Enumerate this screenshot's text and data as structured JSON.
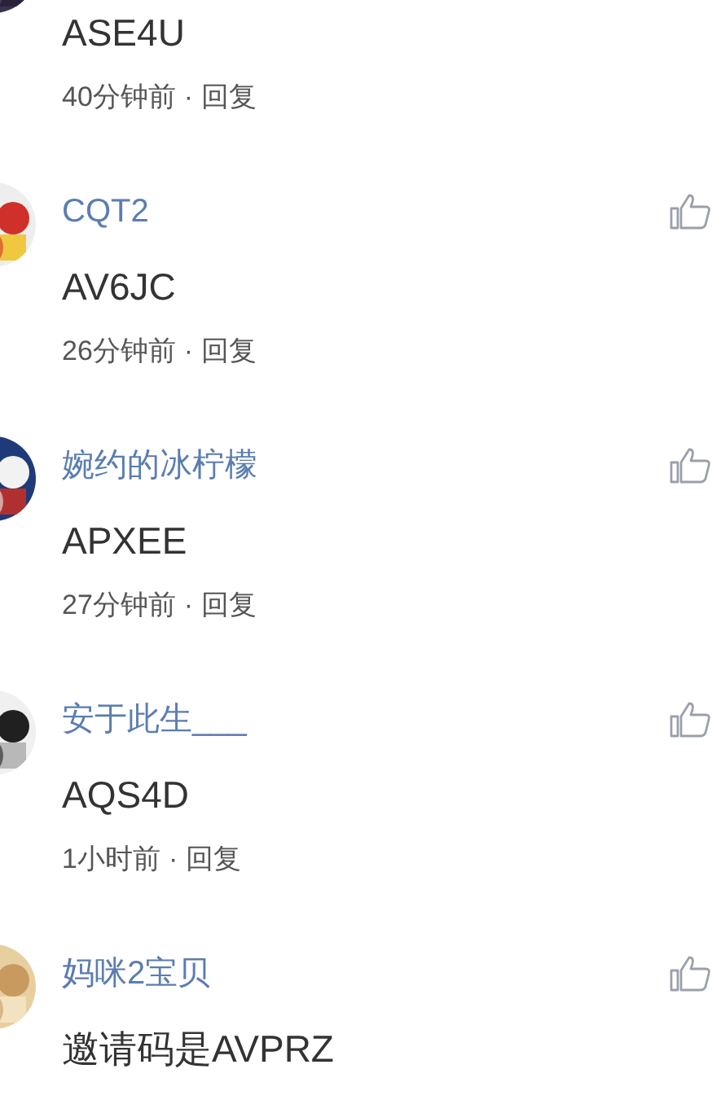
{
  "comments": [
    {
      "content": "ASE4U",
      "time": "40分钟前",
      "separator": "·",
      "reply": "回复"
    },
    {
      "name": "CQT2",
      "content": "AV6JC",
      "time": "26分钟前",
      "separator": "·",
      "reply": "回复"
    },
    {
      "name": "婉约的冰柠檬",
      "content": "APXEE",
      "time": "27分钟前",
      "separator": "·",
      "reply": "回复"
    },
    {
      "name": "安于此生___",
      "content": "AQS4D",
      "time": "1小时前",
      "separator": "·",
      "reply": "回复"
    },
    {
      "name": "妈咪2宝贝",
      "content": "邀请码是AVPRZ"
    }
  ]
}
